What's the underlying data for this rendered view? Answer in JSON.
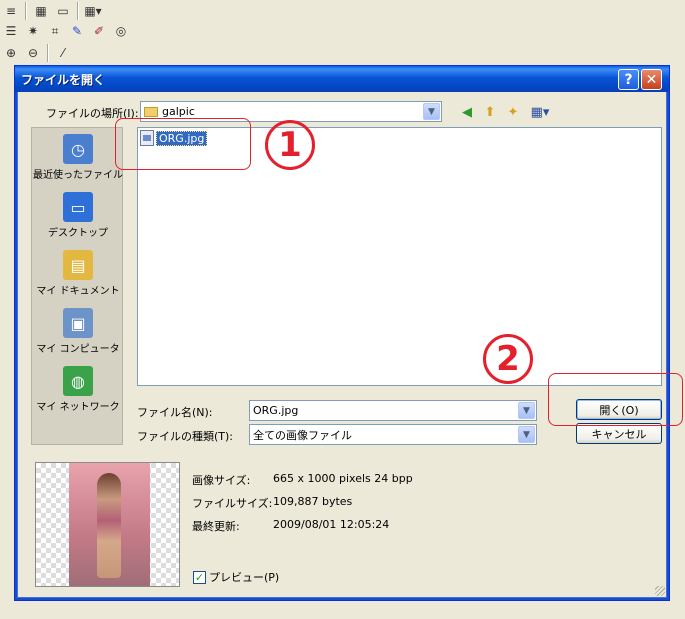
{
  "window": {
    "title": "ファイルを開く",
    "help_label": "?",
    "close_label": "✕"
  },
  "lookin": {
    "label": "ファイルの場所(I):",
    "value": "galpic"
  },
  "places": [
    {
      "label": "最近使ったファイル",
      "icon": "recent-documents-icon",
      "color": "#4a7fd0"
    },
    {
      "label": "デスクトップ",
      "icon": "desktop-icon",
      "color": "#2f6fd8"
    },
    {
      "label": "マイ ドキュメント",
      "icon": "my-documents-icon",
      "color": "#e2b841"
    },
    {
      "label": "マイ コンピュータ",
      "icon": "my-computer-icon",
      "color": "#6c94c9"
    },
    {
      "label": "マイ ネットワーク",
      "icon": "my-network-icon",
      "color": "#3aa34a"
    }
  ],
  "files": [
    {
      "name": "ORG.jpg",
      "selected": true
    }
  ],
  "filename": {
    "label": "ファイル名(N):",
    "value": "ORG.jpg"
  },
  "filetype": {
    "label": "ファイルの種類(T):",
    "value": "全ての画像ファイル"
  },
  "buttons": {
    "open": "開く(O)",
    "cancel": "キャンセル"
  },
  "preview": {
    "rows": [
      {
        "label": "画像サイズ:",
        "value": "665 x 1000 pixels 24 bpp"
      },
      {
        "label": "ファイルサイズ:",
        "value": "109,887 bytes"
      },
      {
        "label": "最終更新:",
        "value": "2009/08/01 12:05:24"
      }
    ],
    "checkbox_label": "プレビュー(P)",
    "checked": true
  },
  "annotations": {
    "step1": "1",
    "step2": "2",
    "color": "#e3202c"
  }
}
